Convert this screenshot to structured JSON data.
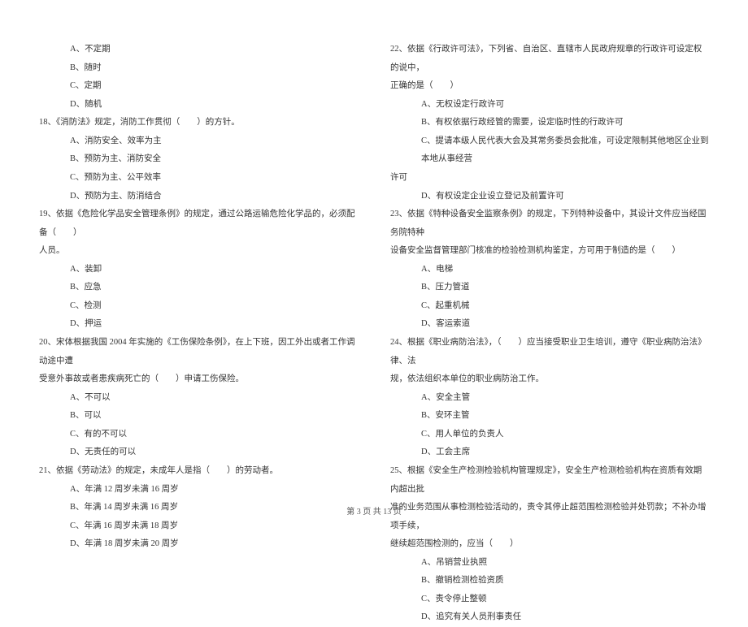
{
  "left": {
    "q17opts": [
      {
        "label": "A、不定期"
      },
      {
        "label": "B、随时"
      },
      {
        "label": "C、定期"
      },
      {
        "label": "D、随机"
      }
    ],
    "q18": "18、《消防法》规定，消防工作贯彻（　　）的方针。",
    "q18opts": [
      {
        "label": "A、消防安全、效率为主"
      },
      {
        "label": "B、预防为主、消防安全"
      },
      {
        "label": "C、预防为主、公平效率"
      },
      {
        "label": "D、预防为主、防消结合"
      }
    ],
    "q19": "19、依据《危险化学品安全管理条例》的规定，通过公路运输危险化学品的，必须配备（　　）",
    "q19_cont": "人员。",
    "q19opts": [
      {
        "label": "A、装卸"
      },
      {
        "label": "B、应急"
      },
      {
        "label": "C、检测"
      },
      {
        "label": "D、押运"
      }
    ],
    "q20": "20、宋体根据我国 2004 年实施的《工伤保险条例》，在上下班，因工外出或者工作调动途中遭",
    "q20_cont": "受意外事故或者患疾病死亡的（　　）申请工伤保险。",
    "q20opts": [
      {
        "label": "A、不可以"
      },
      {
        "label": "B、可以"
      },
      {
        "label": "C、有的不可以"
      },
      {
        "label": "D、无责任的可以"
      }
    ],
    "q21": "21、依据《劳动法》的规定，未成年人是指（　　）的劳动者。",
    "q21opts": [
      {
        "label": "A、年满 12 周岁未满 16 周岁"
      },
      {
        "label": "B、年满 14 周岁未满 16 周岁"
      },
      {
        "label": "C、年满 16 周岁未满 18 周岁"
      },
      {
        "label": "D、年满 18 周岁未满 20 周岁"
      }
    ]
  },
  "right": {
    "q22": "22、依据《行政许可法》，下列省、自治区、直辖市人民政府规章的行政许可设定权的说中，",
    "q22_cont": "正确的是（　　）",
    "q22opts": [
      {
        "label": "A、无权设定行政许可"
      },
      {
        "label": "B、有权依据行政经管的需要，设定临时性的行政许可"
      },
      {
        "label": "C、提请本级人民代表大会及其常务委员会批准，可设定限制其他地区企业到本地从事经营"
      },
      {
        "label_cont": "许可"
      },
      {
        "label_d": "D、有权设定企业设立登记及前置许可"
      }
    ],
    "q23": "23、依据《特种设备安全监察条例》的规定，下列特种设备中，其设计文件应当经国务院特种",
    "q23_cont": "设备安全监督管理部门核准的检验检测机构鉴定，方可用于制造的是（　　）",
    "q23opts": [
      {
        "label": "A、电梯"
      },
      {
        "label": "B、压力管道"
      },
      {
        "label": "C、起重机械"
      },
      {
        "label": "D、客运索道"
      }
    ],
    "q24": "24、根据《职业病防治法》，（　　）应当接受职业卫生培训，遵守《职业病防治法》律、法",
    "q24_cont": "规，依法组织本单位的职业病防治工作。",
    "q24opts": [
      {
        "label": "A、安全主管"
      },
      {
        "label": "B、安环主管"
      },
      {
        "label": "C、用人单位的负责人"
      },
      {
        "label": "D、工会主席"
      }
    ],
    "q25": "25、根据《安全生产检测检验机构管理规定》，安全生产检测检验机构在资质有效期内超出批",
    "q25_cont1": "准的业务范围从事检测检验活动的，责令其停止超范围检测检验并处罚款；不补办增项手续，",
    "q25_cont2": "继续超范围检测的，应当（　　）",
    "q25opts": [
      {
        "label": "A、吊销营业执照"
      },
      {
        "label": "B、撤销检测检验资质"
      },
      {
        "label": "C、责令停止整顿"
      },
      {
        "label": "D、追究有关人员刑事责任"
      }
    ]
  },
  "footer": "第 3 页 共 13 页"
}
